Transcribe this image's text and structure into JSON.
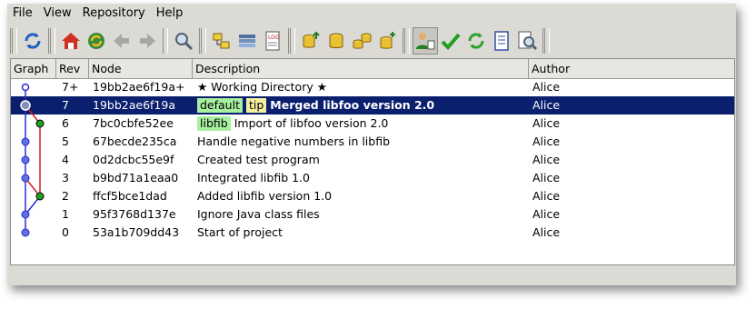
{
  "menubar": {
    "items": [
      "File",
      "View",
      "Repository",
      "Help"
    ]
  },
  "toolbar": {
    "icons": [
      "refresh-icon",
      "home-icon",
      "sync-icon",
      "back-icon",
      "forward-icon",
      "search-icon",
      "branch-icon",
      "stack-icon",
      "log-icon",
      "db-up-icon",
      "db-refresh-icon",
      "db-down-icon",
      "db-merge-icon",
      "user-icon",
      "check-icon",
      "update-icon",
      "document-icon",
      "zoom-document-icon"
    ]
  },
  "table": {
    "headers": {
      "graph": "Graph",
      "rev": "Rev",
      "node": "Node",
      "description": "Description",
      "author": "Author"
    },
    "rows": [
      {
        "rev": "7+",
        "node": "19bb2ae6f19a+",
        "tags": [],
        "description": "★ Working Directory ★",
        "author": "Alice",
        "selected": false,
        "bold": false
      },
      {
        "rev": "7",
        "node": "19bb2ae6f19a",
        "tags": [
          {
            "label": "default",
            "kind": "branch"
          },
          {
            "label": "tip",
            "kind": "tip"
          }
        ],
        "description": "Merged libfoo version 2.0",
        "author": "Alice",
        "selected": true,
        "bold": true
      },
      {
        "rev": "6",
        "node": "7bc0cbfe52ee",
        "tags": [
          {
            "label": "libfib",
            "kind": "branch"
          }
        ],
        "description": "Import of libfoo version 2.0",
        "author": "Alice",
        "selected": false,
        "bold": false
      },
      {
        "rev": "5",
        "node": "67becde235ca",
        "tags": [],
        "description": "Handle negative numbers in libfib",
        "author": "Alice",
        "selected": false,
        "bold": false
      },
      {
        "rev": "4",
        "node": "0d2dcbc55e9f",
        "tags": [],
        "description": "Created test program",
        "author": "Alice",
        "selected": false,
        "bold": false
      },
      {
        "rev": "3",
        "node": "b9bd71a1eaa0",
        "tags": [],
        "description": "Integrated libfib 1.0",
        "author": "Alice",
        "selected": false,
        "bold": false
      },
      {
        "rev": "2",
        "node": "ffcf5bce1dad",
        "tags": [],
        "description": "Added libfib version 1.0",
        "author": "Alice",
        "selected": false,
        "bold": false
      },
      {
        "rev": "1",
        "node": "95f3768d137e",
        "tags": [],
        "description": "Ignore Java class files",
        "author": "Alice",
        "selected": false,
        "bold": false
      },
      {
        "rev": "0",
        "node": "53a1b709dd43",
        "tags": [],
        "description": "Start of project",
        "author": "Alice",
        "selected": false,
        "bold": false
      }
    ]
  },
  "colors": {
    "selection": "#0a1f6e",
    "branch_main": "#2a2ad0",
    "branch_lib": "#d02020",
    "node_main": "#6070e0",
    "node_lib": "#20a020"
  }
}
